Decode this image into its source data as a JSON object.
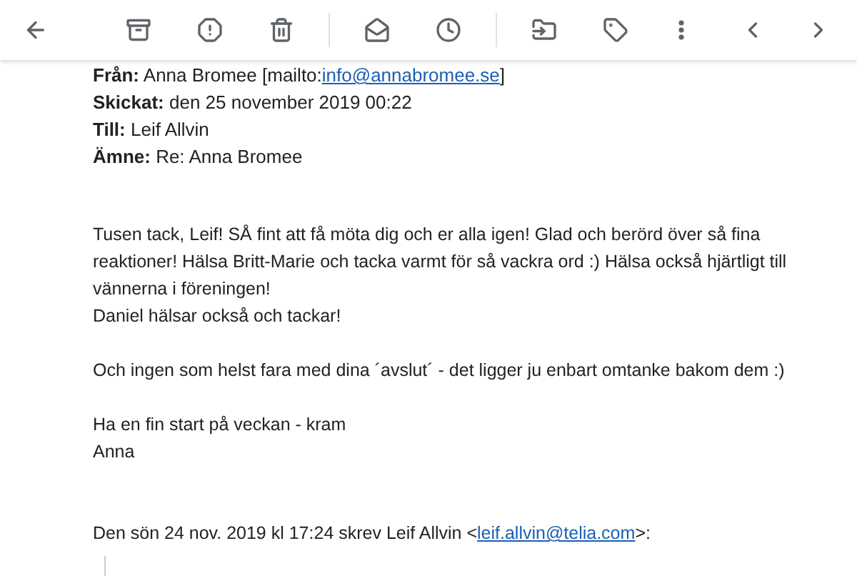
{
  "toolbar": {
    "buttons": [
      {
        "kind": "back"
      },
      {
        "kind": "archive"
      },
      {
        "kind": "spam"
      },
      {
        "kind": "delete"
      },
      {
        "kind": "separator"
      },
      {
        "kind": "unread"
      },
      {
        "kind": "snooze"
      },
      {
        "kind": "separator"
      },
      {
        "kind": "move"
      },
      {
        "kind": "label"
      },
      {
        "kind": "more"
      },
      {
        "kind": "spacer"
      },
      {
        "kind": "prev"
      },
      {
        "kind": "next"
      }
    ]
  },
  "header_fields": [
    {
      "text": "**Från:** Anna Bromee [mailto:",
      "link": "info@annabromee.se",
      "suffix": "]"
    },
    {
      "text": "**Skickat:** den 25 november 2019 00:22"
    },
    {
      "text": "**Till:** Leif Allvin"
    },
    {
      "text": "**Ämne:** Re: Anna Bromee"
    }
  ],
  "body": [
    [
      "Tusen tack, Leif! SÅ fint att få möta dig och er alla igen! Glad och berörd över så fina",
      "reaktioner! Hälsa Britt-Marie och tacka varmt för så vackra ord :) Hälsa också hjärtligt till",
      "vännerna i föreningen!",
      "Daniel hälsar också och tackar!"
    ],
    [
      "Och ingen som helst fara med dina ´avslut´ - det ligger ju enbart omtanke bakom dem :)"
    ],
    [
      "Ha en fin start på veckan - kram",
      "Anna"
    ]
  ],
  "quote_intro": {
    "text": "Den sön 24 nov. 2019 kl 17:24 skrev Leif Allvin <",
    "link": "leif.allvin@telia.com",
    "suffix": ">:"
  }
}
